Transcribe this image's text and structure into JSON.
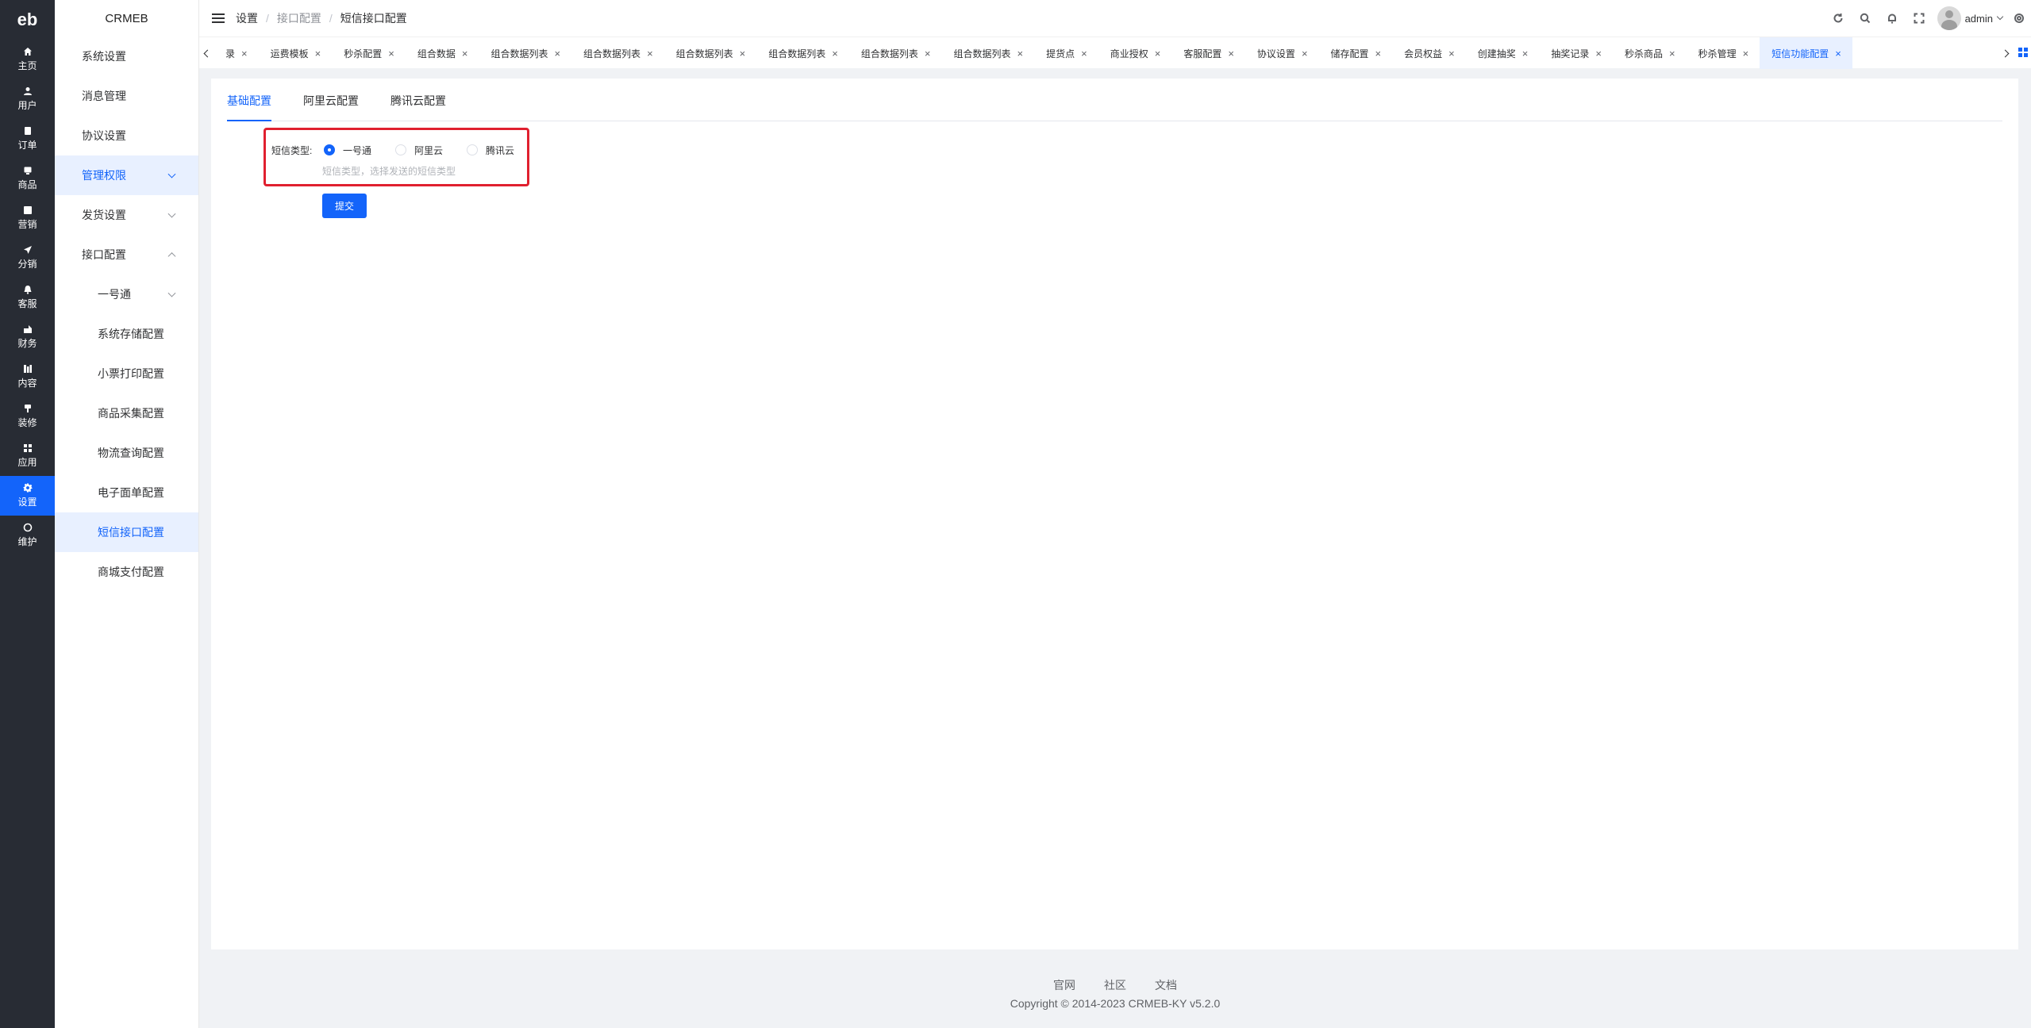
{
  "rail": {
    "logo": "eb",
    "items": [
      {
        "label": "主页",
        "icon": "home-icon"
      },
      {
        "label": "用户",
        "icon": "user-icon"
      },
      {
        "label": "订单",
        "icon": "order-icon"
      },
      {
        "label": "商品",
        "icon": "goods-icon"
      },
      {
        "label": "营销",
        "icon": "marketing-icon"
      },
      {
        "label": "分销",
        "icon": "send-icon"
      },
      {
        "label": "客服",
        "icon": "bell-icon"
      },
      {
        "label": "财务",
        "icon": "finance-icon"
      },
      {
        "label": "内容",
        "icon": "content-icon"
      },
      {
        "label": "装修",
        "icon": "brush-icon"
      },
      {
        "label": "应用",
        "icon": "apps-icon"
      },
      {
        "label": "设置",
        "icon": "gear-icon"
      },
      {
        "label": "维护",
        "icon": "maintain-icon"
      }
    ],
    "active_index": 11
  },
  "submenu": {
    "brand": "CRMEB",
    "items": [
      {
        "label": "系统设置"
      },
      {
        "label": "消息管理"
      },
      {
        "label": "协议设置"
      },
      {
        "label": "管理权限"
      },
      {
        "label": "发货设置"
      },
      {
        "label": "接口配置"
      },
      {
        "label": "一号通"
      },
      {
        "label": "系统存储配置"
      },
      {
        "label": "小票打印配置"
      },
      {
        "label": "商品采集配置"
      },
      {
        "label": "物流查询配置"
      },
      {
        "label": "电子面单配置"
      },
      {
        "label": "短信接口配置"
      },
      {
        "label": "商城支付配置"
      }
    ]
  },
  "header": {
    "breadcrumb": [
      "设置",
      "接口配置",
      "短信接口配置"
    ],
    "user": "admin"
  },
  "tabs": {
    "items": [
      "录",
      "运费模板",
      "秒杀配置",
      "组合数据",
      "组合数据列表",
      "组合数据列表",
      "组合数据列表",
      "组合数据列表",
      "组合数据列表",
      "组合数据列表",
      "提货点",
      "商业授权",
      "客服配置",
      "协议设置",
      "储存配置",
      "会员权益",
      "创建抽奖",
      "抽奖记录",
      "秒杀商品",
      "秒杀管理",
      "短信功能配置"
    ],
    "active_index": 20
  },
  "subtabs": {
    "items": [
      "基础配置",
      "阿里云配置",
      "腾讯云配置"
    ],
    "active_index": 0
  },
  "form": {
    "label": "短信类型:",
    "options": [
      "一号通",
      "阿里云",
      "腾讯云"
    ],
    "selected": "一号通",
    "tip": "短信类型，选择发送的短信类型",
    "submit_label": "提交"
  },
  "footer": {
    "links": [
      "官网",
      "社区",
      "文档"
    ],
    "copyright": "Copyright © 2014-2023 CRMEB-KY v5.2.0"
  },
  "colors": {
    "accent": "#1364fa",
    "rail_bg": "#282c34",
    "highlight_border": "#e0202f"
  }
}
